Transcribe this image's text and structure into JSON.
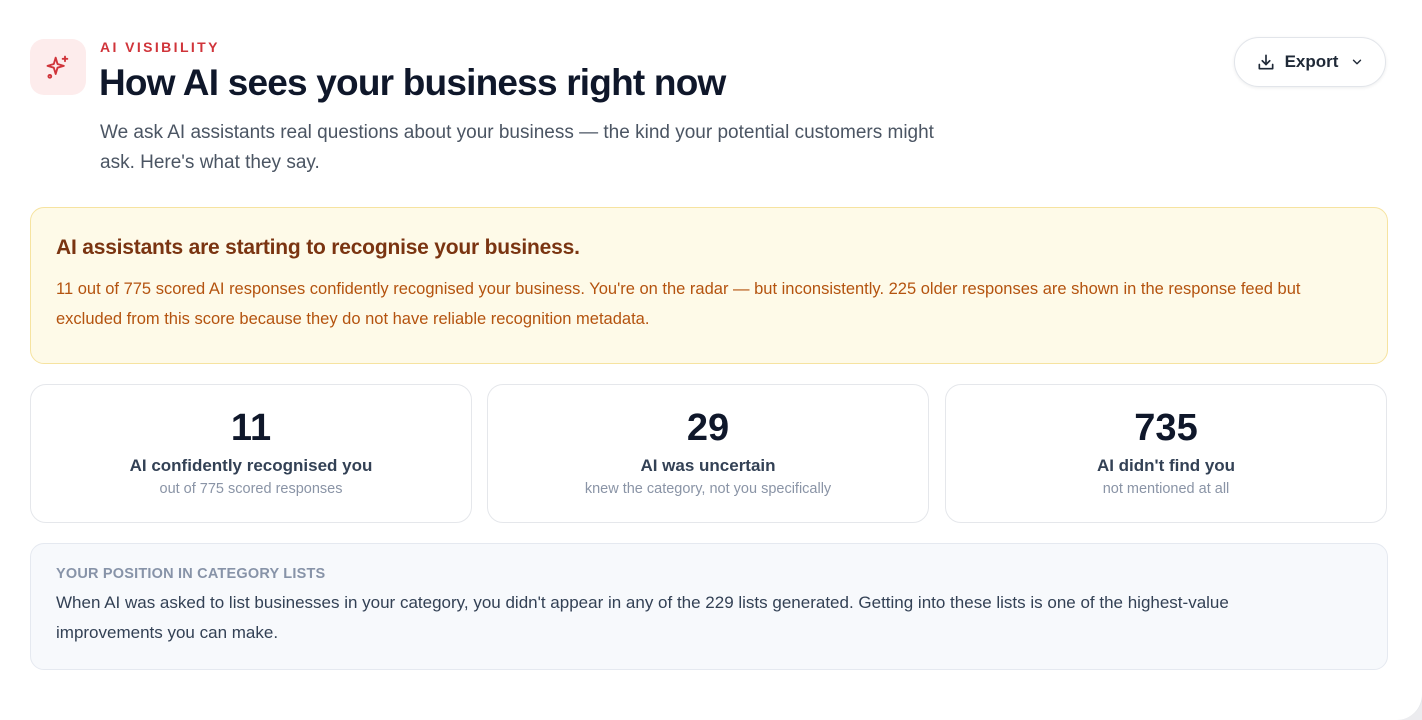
{
  "header": {
    "eyebrow": "AI VISIBILITY",
    "title": "How AI sees your business right now",
    "subtitle": "We ask AI assistants real questions about your business — the kind your potential customers might ask. Here's what they say.",
    "icon": "sparkles-icon"
  },
  "export": {
    "label": "Export",
    "icon": "download-icon",
    "caret_icon": "chevron-down-icon"
  },
  "alert": {
    "title": "AI assistants are starting to recognise your business.",
    "body": "11 out of 775 scored AI responses confidently recognised your business. You're on the radar — but inconsistently. 225 older responses are shown in the response feed but excluded from this score because they do not have reliable recognition metadata."
  },
  "stats": [
    {
      "value": "11",
      "label": "AI confidently recognised you",
      "sub": "out of 775 scored responses"
    },
    {
      "value": "29",
      "label": "AI was uncertain",
      "sub": "knew the category, not you specifically"
    },
    {
      "value": "735",
      "label": "AI didn't find you",
      "sub": "not mentioned at all"
    }
  ],
  "position": {
    "heading": "YOUR POSITION IN CATEGORY LISTS",
    "body": "When AI was asked to list businesses in your category, you didn't appear in any of the 229 lists generated. Getting into these lists is one of the highest-value improvements you can make."
  },
  "colors": {
    "accent": "#d0343a",
    "alert_bg": "#fefae8",
    "alert_title": "#7a3411",
    "alert_text": "#b4530f"
  }
}
